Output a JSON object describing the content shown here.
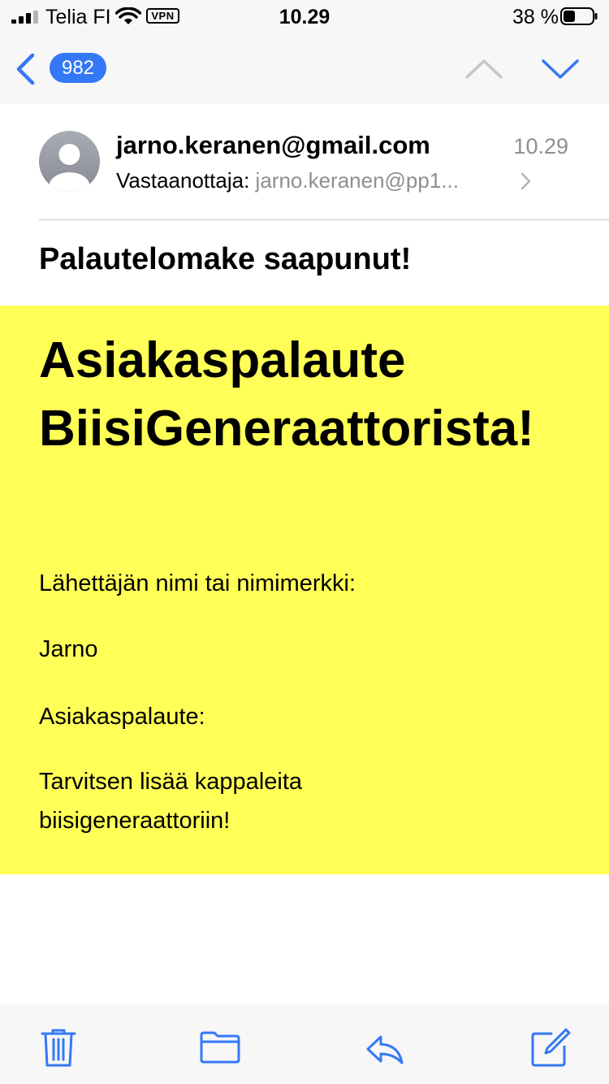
{
  "status_bar": {
    "carrier": "Telia FI",
    "vpn": "VPN",
    "time": "10.29",
    "battery": "38 %"
  },
  "nav": {
    "unread_count": "982"
  },
  "message": {
    "from": "jarno.keranen@gmail.com",
    "time": "10.29",
    "to_label": "Vastaanottaja:",
    "to_value": "jarno.keranen@pp1...",
    "subject": "Palautelomake saapunut!"
  },
  "body": {
    "heading": "Asiakaspalaute BiisiGeneraattorista!",
    "sender_label": "Lähettäjän nimi tai nimimerkki:",
    "sender_value": "Jarno",
    "feedback_label": "Asiakaspalaute:",
    "feedback_line1": "Tarvitsen lisää kappaleita",
    "feedback_line2": "biisigeneraattoriin!"
  },
  "colors": {
    "accent": "#3478f6",
    "body_background": "#ffff57",
    "secondary_text": "#8e8e93"
  },
  "icons": [
    "signal-icon",
    "wifi-icon",
    "battery-icon",
    "back-chevron-icon",
    "chevron-up-icon",
    "chevron-down-icon",
    "avatar-icon",
    "chevron-right-icon",
    "trash-icon",
    "folder-icon",
    "reply-icon",
    "compose-icon"
  ]
}
